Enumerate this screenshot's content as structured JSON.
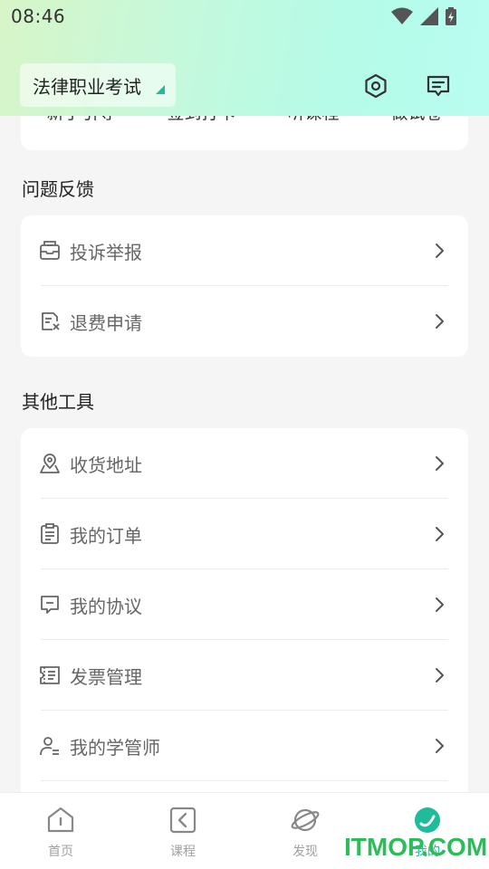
{
  "status_bar": {
    "time": "08:46"
  },
  "top_nav": {
    "exam_selector_label": "法律职业考试"
  },
  "quick_actions": [
    "新手引导",
    "签到打卡",
    "听课程",
    "做试卷"
  ],
  "feedback_section": {
    "title": "问题反馈",
    "items": [
      {
        "label": "投诉举报",
        "icon": "complaint-icon"
      },
      {
        "label": "退费申请",
        "icon": "refund-icon"
      }
    ]
  },
  "tools_section": {
    "title": "其他工具",
    "items": [
      {
        "label": "收货地址",
        "icon": "location-icon"
      },
      {
        "label": "我的订单",
        "icon": "order-icon"
      },
      {
        "label": "我的协议",
        "icon": "agreement-icon"
      },
      {
        "label": "发票管理",
        "icon": "invoice-icon"
      },
      {
        "label": "我的学管师",
        "icon": "tutor-icon"
      }
    ]
  },
  "tab_bar": {
    "items": [
      {
        "label": "首页",
        "icon": "home-icon"
      },
      {
        "label": "课程",
        "icon": "course-icon"
      },
      {
        "label": "发现",
        "icon": "discover-icon"
      },
      {
        "label": "我的",
        "icon": "profile-icon"
      }
    ],
    "active_index": 3
  },
  "watermark": "ITMOP.COM",
  "colors": {
    "accent": "#1ebc9a",
    "header_gradient_start": "#d8f5c8",
    "header_gradient_end": "#b8fdf0"
  }
}
